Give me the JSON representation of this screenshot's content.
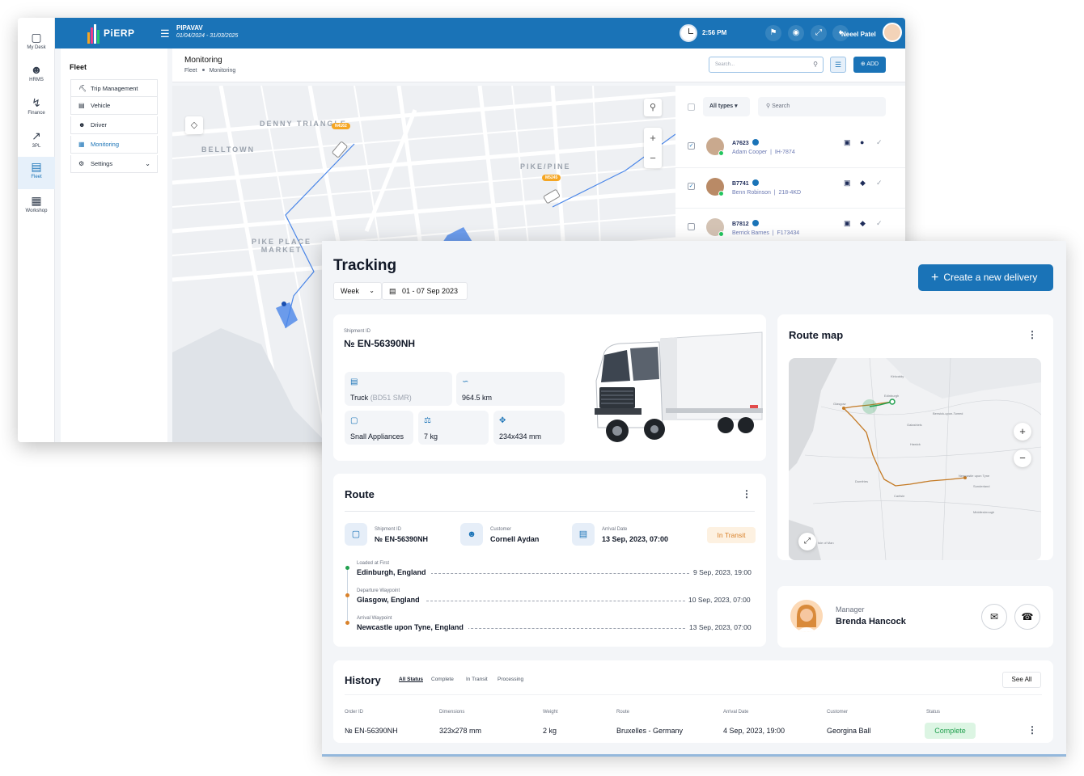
{
  "erp": {
    "rail": [
      {
        "label": "My Desk",
        "icon": "desk-icon"
      },
      {
        "label": "HRMS",
        "icon": "people-icon"
      },
      {
        "label": "Finance",
        "icon": "chart-icon"
      },
      {
        "label": "3PL",
        "icon": "trend-icon"
      },
      {
        "label": "Fleet",
        "icon": "truck-icon"
      },
      {
        "label": "Workshop",
        "icon": "garage-icon"
      }
    ],
    "logo_text": "PiERP",
    "company": "PIPAVAV",
    "period": "01/04/2024 - 31/03/2025",
    "time": "2:56 PM",
    "user": "Neeel Patel",
    "fleet_title": "Fleet",
    "fleet_menu": [
      "Trip Management",
      "Vehicle",
      "Driver",
      "Monitoring",
      "Settings"
    ],
    "page_title": "Monitoring",
    "breadcrumb": [
      "Fleet",
      "Monitoring"
    ],
    "search_placeholder": "Search...",
    "add_label": "ADD",
    "map_labels": [
      "DENNY TRIANGLE",
      "BELLTOWN",
      "PIKE/PINE",
      "PIKE PLACE MARKET"
    ],
    "map_badges": [
      "N4162",
      "M5245"
    ],
    "types_label": "All types",
    "list_search": "Search",
    "vehicles": [
      {
        "code": "A7623",
        "driver": "Adam Cooper",
        "plate": "IH-7874",
        "checked": true
      },
      {
        "code": "B7741",
        "driver": "Benn Robinson",
        "plate": "218-4KD",
        "checked": true
      },
      {
        "code": "B7812",
        "driver": "Berrick Barnes",
        "plate": "F173434",
        "checked": false
      }
    ]
  },
  "tracking": {
    "title": "Tracking",
    "period_select": "Week",
    "date_range": "01 - 07 Sep 2023",
    "create_label": "Create a new delivery",
    "shipment": {
      "id_label": "Shipment ID",
      "id": "№ EN-56390NH",
      "vehicle": "Truck",
      "vehicle_reg": "(BD51 SMR)",
      "distance": "964.5 km",
      "cargo": "Snall Appliances",
      "weight": "7 kg",
      "dimensions": "234x434 mm"
    },
    "route": {
      "title": "Route",
      "shipment_label": "Shipment ID",
      "shipment_id": "№ EN-56390NH",
      "customer_label": "Customer",
      "customer": "Cornell Aydan",
      "arrival_label": "Arrival Date",
      "arrival": "13 Sep, 2023, 07:00",
      "status": "In Transit",
      "waypoints": [
        {
          "label": "Loaded at First",
          "place": "Edinburgh, England",
          "time": "9 Sep, 2023, 19:00",
          "color": "#22a04f"
        },
        {
          "label": "Departure Waypoint",
          "place": "Glasgow, England",
          "time": "10 Sep, 2023, 07:00",
          "color": "#d9822b"
        },
        {
          "label": "Arrival Waypoint",
          "place": "Newcastle upon Tyne, England",
          "time": "13 Sep, 2023, 07:00",
          "color": "#d9822b"
        }
      ]
    },
    "route_map": {
      "title": "Route map",
      "towns": [
        "Edinburgh",
        "Glasgow",
        "Newcastle upon Tyne",
        "Sunderland",
        "Middlesbrough",
        "Isle of Man",
        "Carlisle",
        "Dumfries",
        "Berwick-upon-Tweed",
        "Galashiels",
        "Hawick",
        "Kirkcaldy"
      ]
    },
    "manager": {
      "role": "Manager",
      "name": "Brenda Hancock"
    },
    "history": {
      "title": "History",
      "tabs": [
        "All Status",
        "Complete",
        "In Transit",
        "Processing"
      ],
      "see_all": "See All",
      "columns": [
        "Order ID",
        "Dimensions",
        "Weight",
        "Route",
        "Arrival Date",
        "Customer",
        "Status"
      ],
      "row": {
        "order_id": "№ EN-56390NH",
        "dimensions": "323x278 mm",
        "weight": "2 kg",
        "route": "Bruxelles - Germany",
        "arrival": "4 Sep, 2023, 19:00",
        "customer": "Georgina Ball",
        "status": "Complete"
      }
    }
  }
}
